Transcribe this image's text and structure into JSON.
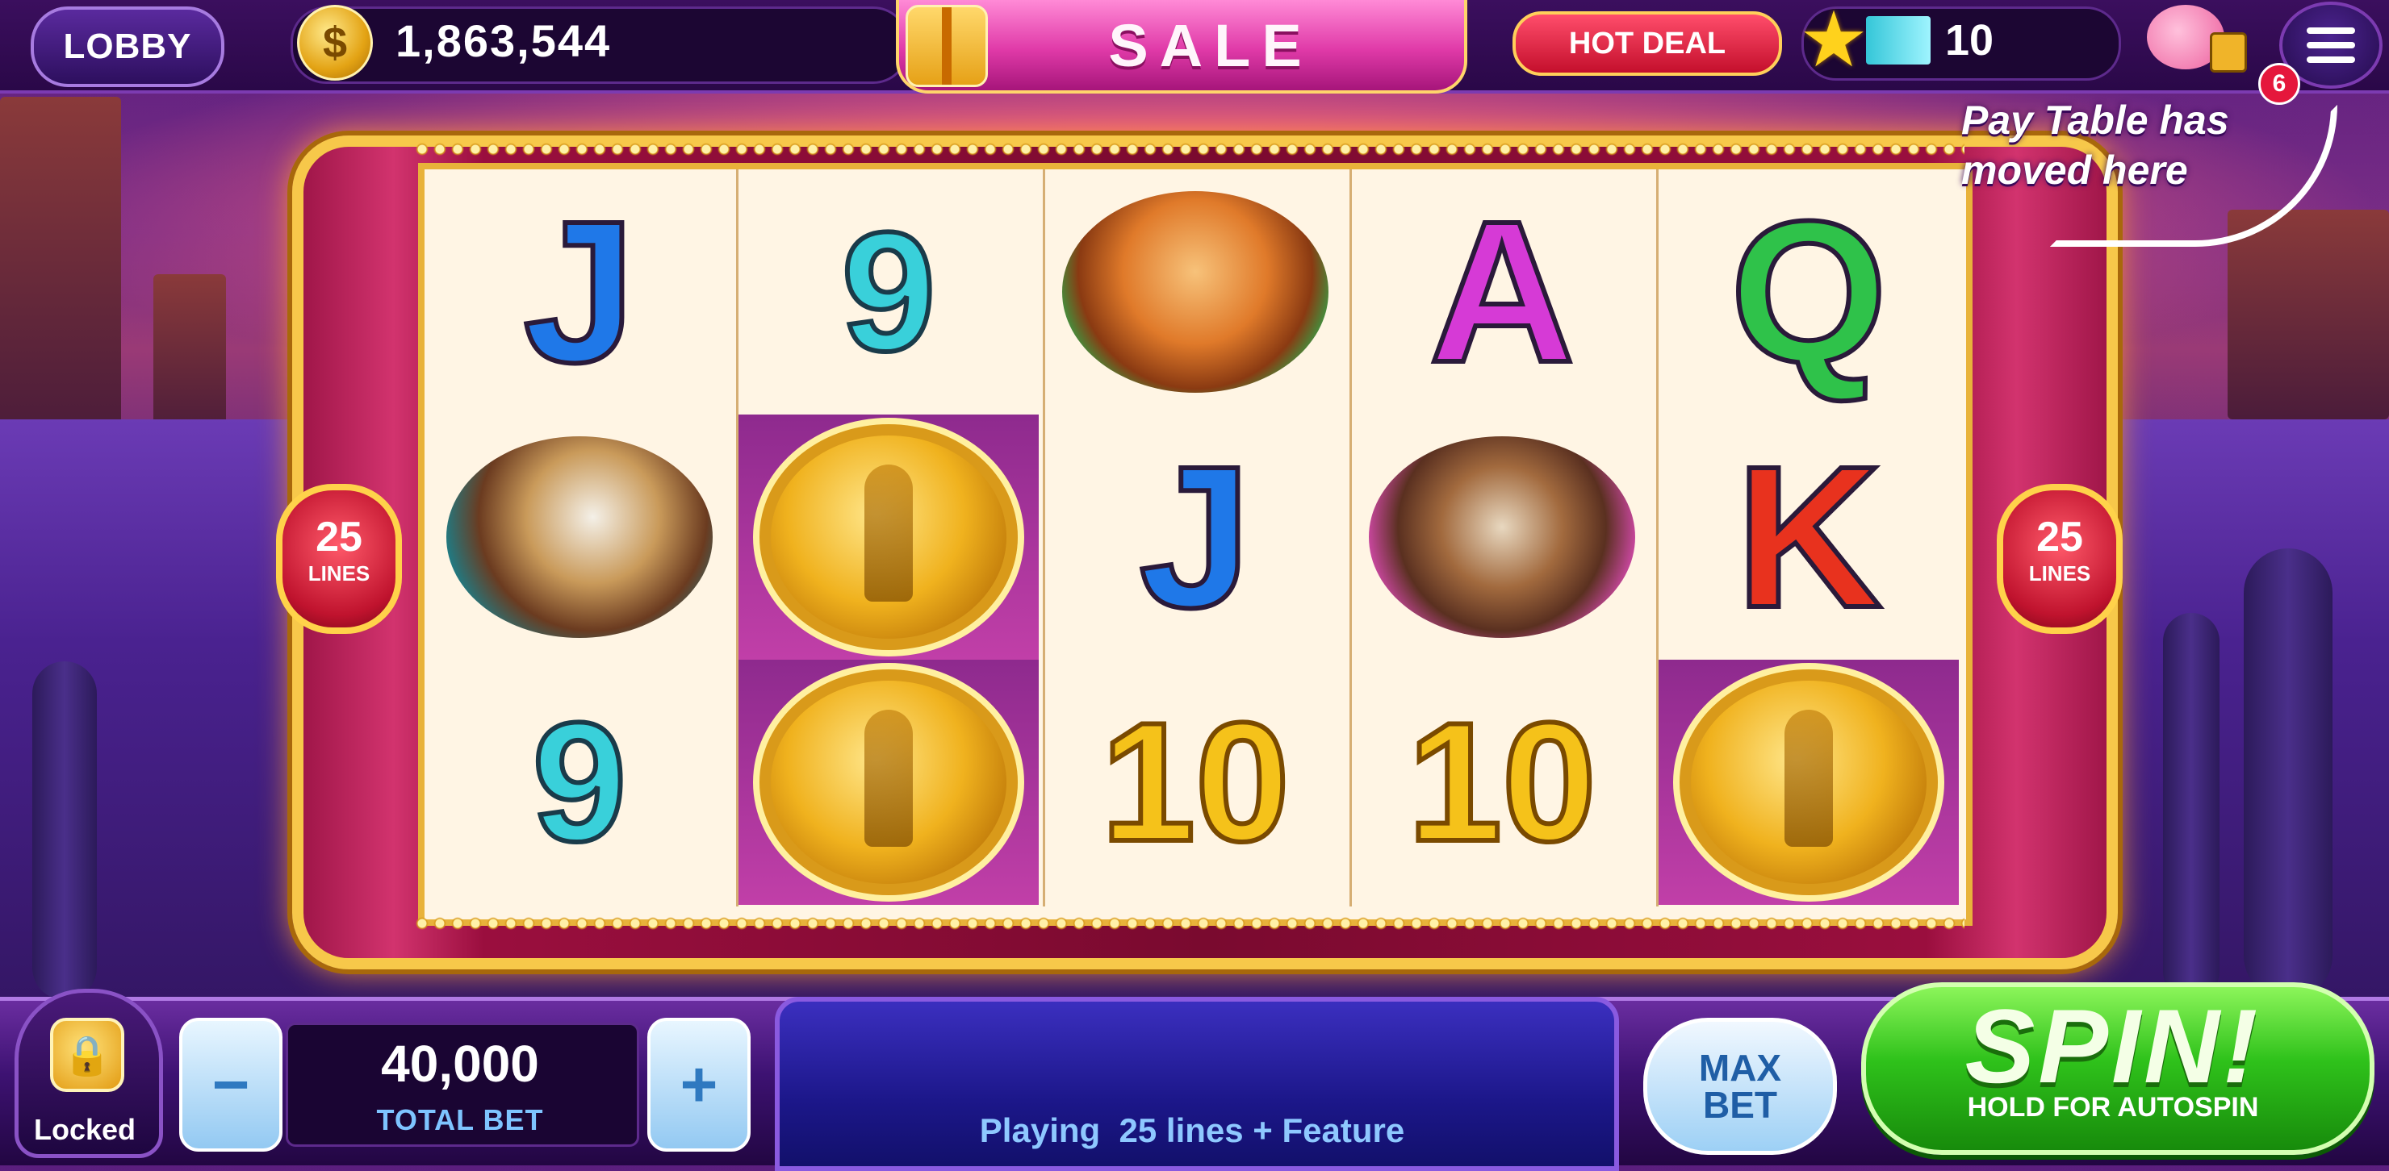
{
  "topbar": {
    "lobby_label": "LOBBY",
    "coin_balance": "1,863,544",
    "coin_icon": "coin-icon",
    "sale_label": "SALE",
    "hot_deal_label": "HOT DEAL",
    "level": "10",
    "notification_count": "6"
  },
  "hint": {
    "line1": "Pay Table has",
    "line2": "moved here"
  },
  "reels": {
    "lines_left": "25",
    "lines_right": "25",
    "lines_label": "LINES",
    "symbols": [
      [
        "J",
        "eagle",
        "9"
      ],
      [
        "9",
        "gold-coin",
        "gold-coin"
      ],
      [
        "cougar",
        "J",
        "10"
      ],
      [
        "A",
        "ram",
        "10"
      ],
      [
        "Q",
        "K",
        "gold-coin"
      ]
    ]
  },
  "bottombar": {
    "locked_label": "Locked",
    "minus_label": "−",
    "plus_label": "+",
    "total_bet_value": "40,000",
    "total_bet_label": "TOTAL BET",
    "status_message": "Playing  25 lines + Feature",
    "max_bet_line1": "MAX",
    "max_bet_line2": "BET",
    "spin_label": "SPIN!",
    "spin_sub": "HOLD FOR AUTOSPIN"
  },
  "colors": {
    "accent_gold": "#f7c84a",
    "spin_green": "#2fc21b",
    "sale_pink": "#e03aa8",
    "hot_deal_red": "#c40f2c"
  }
}
